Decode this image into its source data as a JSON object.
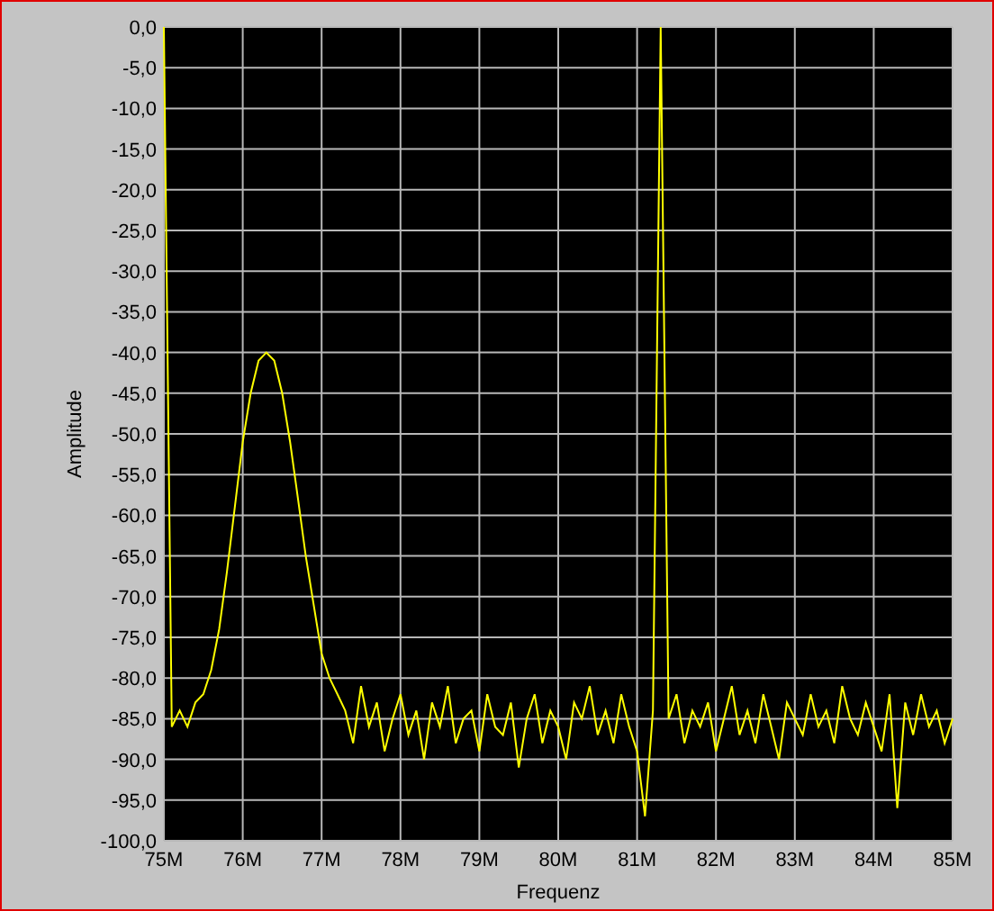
{
  "graph": {
    "chart_data": {
      "type": "line",
      "grid": true,
      "xlabel": "Frequenz",
      "ylabel": "Amplitude",
      "x": [
        75.0,
        75.1,
        75.2,
        75.3,
        75.4,
        75.5,
        75.6,
        75.7,
        75.8,
        75.9,
        76.0,
        76.1,
        76.2,
        76.3,
        76.4,
        76.5,
        76.6,
        76.7,
        76.8,
        76.9,
        77.0,
        77.1,
        77.2,
        77.3,
        77.4,
        77.5,
        77.6,
        77.7,
        77.8,
        77.9,
        78.0,
        78.1,
        78.2,
        78.3,
        78.4,
        78.5,
        78.6,
        78.7,
        78.8,
        78.9,
        79.0,
        79.1,
        79.2,
        79.3,
        79.4,
        79.5,
        79.6,
        79.7,
        79.8,
        79.9,
        80.0,
        80.1,
        80.2,
        80.3,
        80.4,
        80.5,
        80.6,
        80.7,
        80.8,
        80.9,
        81.0,
        81.1,
        81.2,
        81.3,
        81.4,
        81.5,
        81.6,
        81.7,
        81.8,
        81.9,
        82.0,
        82.1,
        82.2,
        82.3,
        82.4,
        82.5,
        82.6,
        82.7,
        82.8,
        82.9,
        83.0,
        83.1,
        83.2,
        83.3,
        83.4,
        83.5,
        83.6,
        83.7,
        83.8,
        83.9,
        84.0,
        84.1,
        84.2,
        84.3,
        84.4,
        84.5,
        84.6,
        84.7,
        84.8,
        84.9,
        85.0
      ],
      "series": [
        {
          "color": "#ffff00",
          "values": [
            0,
            -86,
            -84,
            -86,
            -83,
            -82,
            -79,
            -74,
            -67,
            -59,
            -51,
            -45,
            -41,
            -40,
            -41,
            -45,
            -51,
            -58,
            -65,
            -71,
            -77,
            -80,
            -82,
            -84,
            -88,
            -81,
            -86,
            -83,
            -89,
            -85,
            -82,
            -87,
            -84,
            -90,
            -83,
            -86,
            -81,
            -88,
            -85,
            -84,
            -89,
            -82,
            -86,
            -87,
            -83,
            -91,
            -85,
            -82,
            -88,
            -84,
            -86,
            -90,
            -83,
            -85,
            -81,
            -87,
            -84,
            -88,
            -82,
            -86,
            -89,
            -97,
            -84,
            0,
            -85,
            -82,
            -88,
            -84,
            -86,
            -83,
            -89,
            -85,
            -81,
            -87,
            -84,
            -88,
            -82,
            -86,
            -90,
            -83,
            -85,
            -87,
            -82,
            -86,
            -84,
            -88,
            -81,
            -85,
            -87,
            -83,
            -86,
            -89,
            -82,
            -96,
            -83,
            -87,
            -82,
            -86,
            -84,
            -88,
            -85
          ]
        }
      ],
      "xlim": [
        75,
        85
      ],
      "ylim": [
        -100,
        0
      ],
      "xticks": [
        {
          "value": 75,
          "label": "75M"
        },
        {
          "value": 76,
          "label": "76M"
        },
        {
          "value": 77,
          "label": "77M"
        },
        {
          "value": 78,
          "label": "78M"
        },
        {
          "value": 79,
          "label": "79M"
        },
        {
          "value": 80,
          "label": "80M"
        },
        {
          "value": 81,
          "label": "81M"
        },
        {
          "value": 82,
          "label": "82M"
        },
        {
          "value": 83,
          "label": "83M"
        },
        {
          "value": 84,
          "label": "84M"
        },
        {
          "value": 85,
          "label": "85M"
        }
      ],
      "yticks": [
        {
          "value": 0,
          "label": "0,0"
        },
        {
          "value": -5,
          "label": "-5,0"
        },
        {
          "value": -10,
          "label": "-10,0"
        },
        {
          "value": -15,
          "label": "-15,0"
        },
        {
          "value": -20,
          "label": "-20,0"
        },
        {
          "value": -25,
          "label": "-25,0"
        },
        {
          "value": -30,
          "label": "-30,0"
        },
        {
          "value": -35,
          "label": "-35,0"
        },
        {
          "value": -40,
          "label": "-40,0"
        },
        {
          "value": -45,
          "label": "-45,0"
        },
        {
          "value": -50,
          "label": "-50,0"
        },
        {
          "value": -55,
          "label": "-55,0"
        },
        {
          "value": -60,
          "label": "-60,0"
        },
        {
          "value": -65,
          "label": "-65,0"
        },
        {
          "value": -70,
          "label": "-70,0"
        },
        {
          "value": -75,
          "label": "-75,0"
        },
        {
          "value": -80,
          "label": "-80,0"
        },
        {
          "value": -85,
          "label": "-85,0"
        },
        {
          "value": -90,
          "label": "-90,0"
        },
        {
          "value": -95,
          "label": "-95,0"
        },
        {
          "value": -100,
          "label": "-100,0"
        }
      ]
    }
  }
}
